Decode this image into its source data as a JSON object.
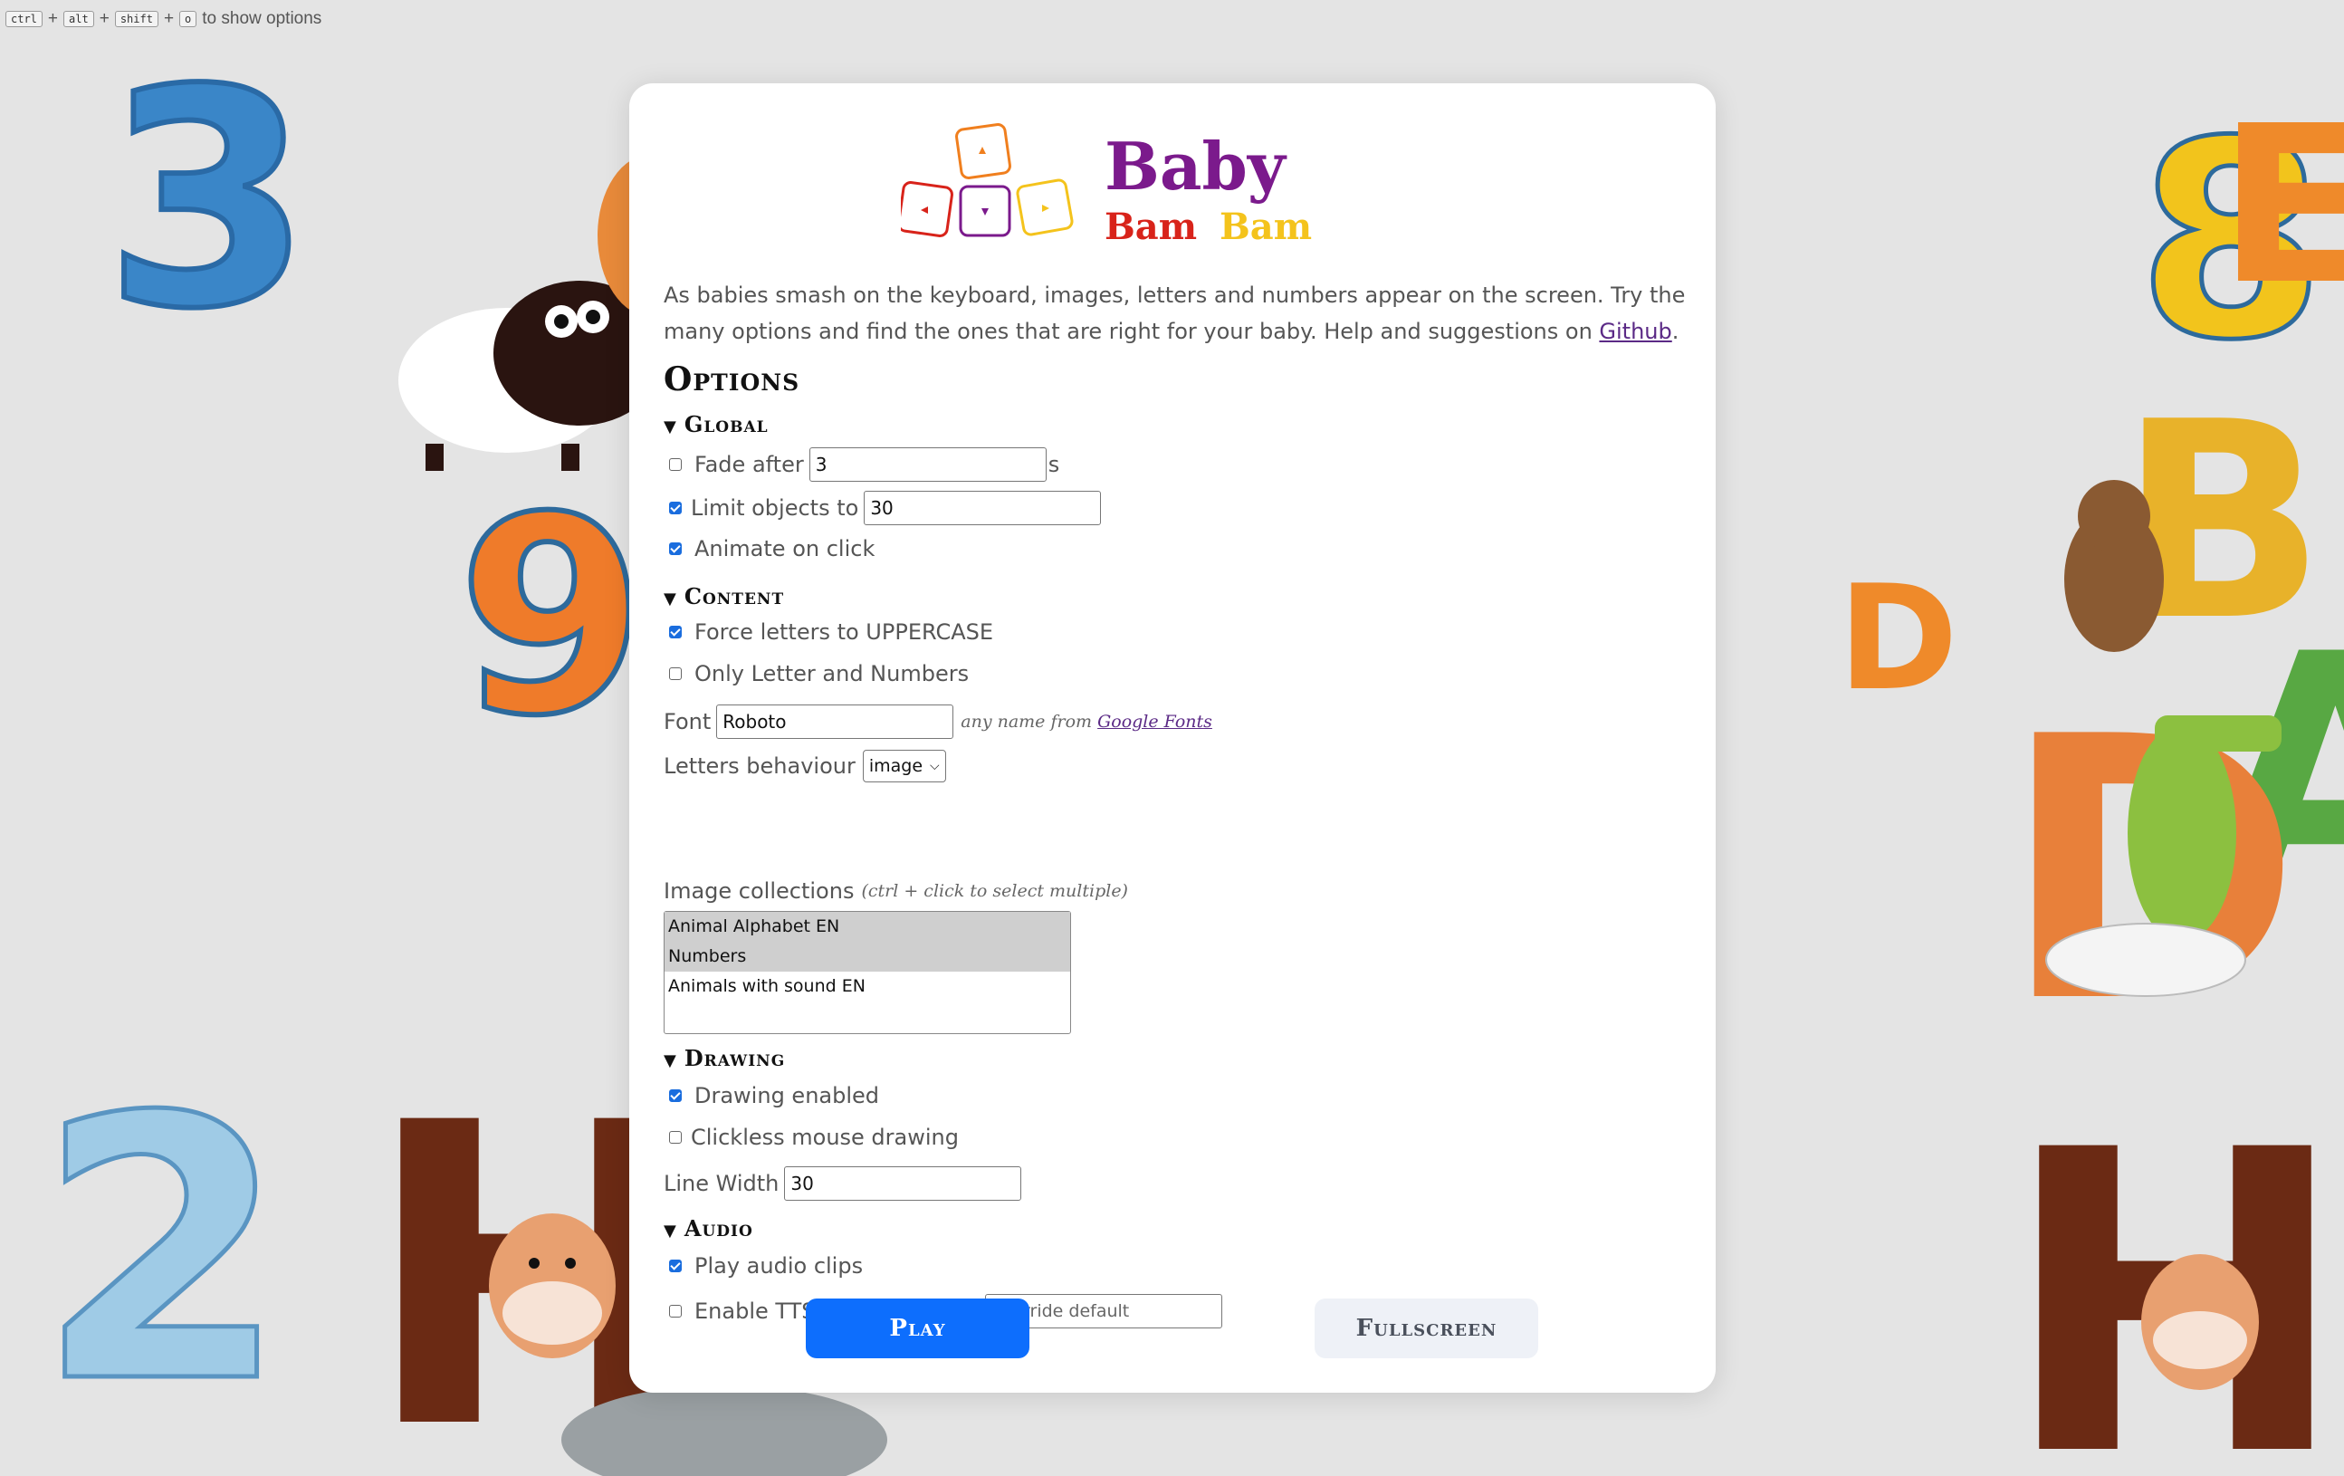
{
  "hint": {
    "keys": [
      "ctrl",
      "alt",
      "shift",
      "o"
    ],
    "plus": "+",
    "text": "to show options"
  },
  "background": {
    "letters": [
      "3",
      "9",
      "2",
      "H",
      "8",
      "E",
      "B",
      "D",
      "A",
      "D",
      "H"
    ]
  },
  "logo": {
    "line1": "Baby",
    "line2a": "Bam",
    "line2b": "Bam",
    "colors": {
      "purple": "#7b1a8c",
      "red": "#d8231a",
      "yellow": "#f4c31c",
      "orange": "#f07f1e"
    }
  },
  "description": {
    "text": "As babies smash on the keyboard, images, letters and numbers appear on the screen. Try the many options and find the ones that are right for your baby. Help and suggestions on ",
    "link": "Github",
    "end": "."
  },
  "options_title": "Options",
  "global": {
    "title": "Global",
    "fade_label": "Fade after",
    "fade_value": "3",
    "fade_unit": "s",
    "fade_checked": false,
    "limit_label": "Limit objects to",
    "limit_value": "30",
    "limit_checked": true,
    "animate_label": "Animate on click",
    "animate_checked": true
  },
  "content": {
    "title": "Content",
    "uppercase_label": "Force letters to UPPERCASE",
    "uppercase_checked": true,
    "only_label": "Only Letter and Numbers",
    "only_checked": false,
    "font_label": "Font",
    "font_value": "Roboto",
    "font_note": "any name from",
    "font_link": "Google Fonts",
    "behaviour_label": "Letters behaviour",
    "behaviour_value": "image",
    "collections_label": "Image collections",
    "collections_note": "(ctrl + click to select multiple)",
    "collections": [
      {
        "label": "Animal Alphabet EN",
        "selected": true
      },
      {
        "label": "Numbers",
        "selected": true
      },
      {
        "label": "Animals with sound EN",
        "selected": false
      }
    ]
  },
  "drawing": {
    "title": "Drawing",
    "enabled_label": "Drawing enabled",
    "enabled_checked": true,
    "clickless_label": "Clickless mouse drawing",
    "clickless_checked": false,
    "width_label": "Line Width",
    "width_value": "30"
  },
  "audio": {
    "title": "Audio",
    "play_label": "Play audio clips",
    "play_checked": true,
    "tts_label": "Enable TTS , lang override",
    "tts_checked": false,
    "tts_placeholder": "override default"
  },
  "buttons": {
    "play": "Play",
    "fullscreen": "Fullscreen"
  }
}
